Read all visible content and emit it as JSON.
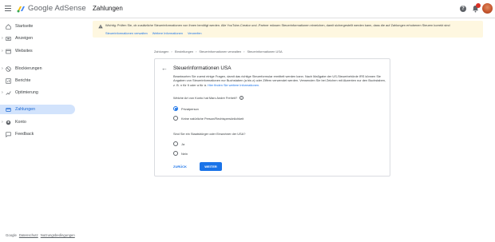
{
  "header": {
    "app_name": "Google AdSense",
    "page_title": "Zahlungen",
    "help_icon": "help-icon",
    "bell_icon": "notifications-icon"
  },
  "sidebar": {
    "items": [
      {
        "label": "Startseite",
        "icon": "home-icon"
      },
      {
        "label": "Anzeigen",
        "icon": "ads-icon"
      },
      {
        "label": "Websites",
        "icon": "websites-icon"
      },
      {
        "label": "Blockierungen",
        "icon": "block-icon"
      },
      {
        "label": "Berichte",
        "icon": "reports-icon"
      },
      {
        "label": "Optimierung",
        "icon": "optimization-icon"
      },
      {
        "label": "Zahlungen",
        "icon": "payments-icon"
      },
      {
        "label": "Konto",
        "icon": "account-icon"
      },
      {
        "label": "Feedback",
        "icon": "feedback-icon"
      }
    ],
    "footer": {
      "brand": "Google",
      "privacy": "Datenschutz",
      "terms": "Nutzungsbedingungen"
    }
  },
  "banner": {
    "text": "Wichtig: Prüfen Sie, ob zusätzliche Steuerinformationen von Ihnen benötigt werden. Alle YouTube-Creator und -Partner müssen Steuerinformationen einreichen, damit sichergestellt werden kann, dass die auf Zahlungen erhobenen Steuern korrekt sind",
    "links": [
      "Steuerinformationen verwalten",
      "Weitere Informationen",
      "Verwerfen"
    ]
  },
  "breadcrumb": [
    "Zahlungen",
    "Einstellungen",
    "Steuerinformationen verwalten",
    "Steuerinformationen USA"
  ],
  "card": {
    "title": "Steuerinformationen USA",
    "desc_line1": "Beantworten Sie zuerst einige Fragen, damit das richtige Steuerformular ermittelt werden kann. Nach Maßgabe der US-Steuerbehörde IRS können Sie",
    "desc_line2": "Angaben von Steuerinformationen nur Buchstaben (a bis z) oder Ziffern verwendet werden. Verwenden Sie bei Zeichen mit Akzenten nur den",
    "desc_line3": "Buchstaben, z. B. n für ñ oder a für á.",
    "desc_link": "Hier finden Sie weitere Informationen.",
    "question1": "Welche Art von Konto hat Marc Andre Freheit?",
    "options1": [
      "Privatperson",
      "Keine natürliche Person/Rechtspersönlichkeit"
    ],
    "question2": "Sind Sie ein Staatsbürger oder Einwohner der USA?",
    "options2": [
      "Ja",
      "Nein"
    ],
    "back_label": "ZURÜCK",
    "next_label": "WEITER"
  }
}
